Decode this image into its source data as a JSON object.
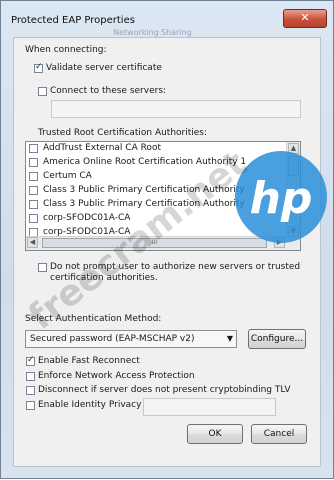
{
  "window": {
    "title": "Protected EAP Properties",
    "close_glyph": "✕",
    "background_text": [
      "Networking",
      "Sharing"
    ]
  },
  "connecting": {
    "heading": "When connecting:",
    "validate_label": "Validate server certificate",
    "validate_checked": true,
    "connect_servers_label": "Connect to these servers:",
    "connect_servers_checked": false,
    "servers_value": ""
  },
  "trusted_roots": {
    "heading": "Trusted Root Certification Authorities:",
    "items": [
      {
        "label": "AddTrust External CA Root",
        "checked": false
      },
      {
        "label": "America Online Root Certification Authority 1",
        "checked": false
      },
      {
        "label": "Certum CA",
        "checked": false
      },
      {
        "label": "Class 3 Public Primary Certification Authority",
        "checked": false
      },
      {
        "label": "Class 3 Public Primary Certification Authority",
        "checked": false
      },
      {
        "label": "corp-SFODC01A-CA",
        "checked": false
      },
      {
        "label": "corp-SFODC01A-CA",
        "checked": false
      }
    ],
    "scroll_up": "▲",
    "scroll_down": "▼",
    "scroll_left": "◀",
    "scroll_right": "▶",
    "hthumb_grip": "III"
  },
  "prompt_option": {
    "line1": "Do not prompt user to authorize new servers or trusted",
    "line2": "certification authorities.",
    "checked": false
  },
  "auth": {
    "heading": "Select Authentication Method:",
    "selected": "Secured password (EAP-MSCHAP v2)",
    "dropdown_arrow": "▼",
    "configure_label": "Configure..."
  },
  "options": [
    {
      "label": "Enable Fast Reconnect",
      "checked": true
    },
    {
      "label": "Enforce Network Access Protection",
      "checked": false
    },
    {
      "label": "Disconnect if server does not present cryptobinding TLV",
      "checked": false
    },
    {
      "label": "Enable Identity Privacy",
      "checked": false
    }
  ],
  "identity_value": "",
  "buttons": {
    "ok": "OK",
    "cancel": "Cancel"
  },
  "watermark": {
    "text": "freecram.net",
    "logo_text": "hp",
    "color": "#2a8fd8"
  }
}
